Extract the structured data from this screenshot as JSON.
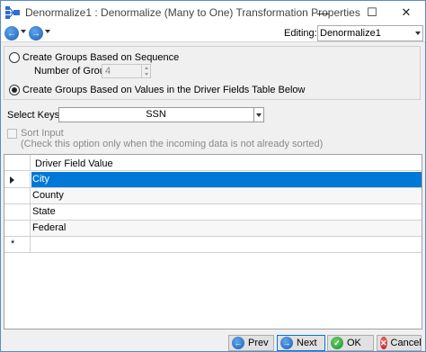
{
  "window": {
    "title": "Denormalize1 : Denormalize (Many to One) Transformation Properties",
    "minimize_glyph": "—",
    "maximize_glyph": "☐",
    "close_glyph": "✕",
    "app_icon": "denormalize-transform-icon"
  },
  "toolbar": {
    "back_icon": "back-arrow-icon",
    "forward_icon": "forward-arrow-icon",
    "editing_label": "Editing:",
    "editing_value": "Denormalize1"
  },
  "grouping": {
    "option_sequence_label": "Create Groups Based on Sequence",
    "option_sequence_selected": false,
    "number_of_groups_label": "Number of Groups",
    "number_of_groups_value": "4",
    "option_driver_label": "Create Groups Based on Values in the Driver Fields Table Below",
    "option_driver_selected": true
  },
  "keys": {
    "label": "Select Keys :",
    "value": "SSN"
  },
  "sort": {
    "label": "Sort Input",
    "note": "(Check this option only when the incoming data is not already sorted)",
    "checked": false
  },
  "grid": {
    "column_header": "Driver Field Value",
    "rows": [
      {
        "value": "City",
        "selected": true
      },
      {
        "value": "County",
        "selected": false
      },
      {
        "value": "State",
        "selected": false
      },
      {
        "value": "Federal",
        "selected": false
      }
    ],
    "new_row_marker": "*"
  },
  "buttons": {
    "prev": "Prev",
    "next": "Next",
    "ok": "OK",
    "cancel": "Cancel"
  },
  "colors": {
    "selection": "#0078d7",
    "accent_blue": "#1f5fb6",
    "ok_green": "#1f8f2a",
    "cancel_red": "#c01818"
  }
}
